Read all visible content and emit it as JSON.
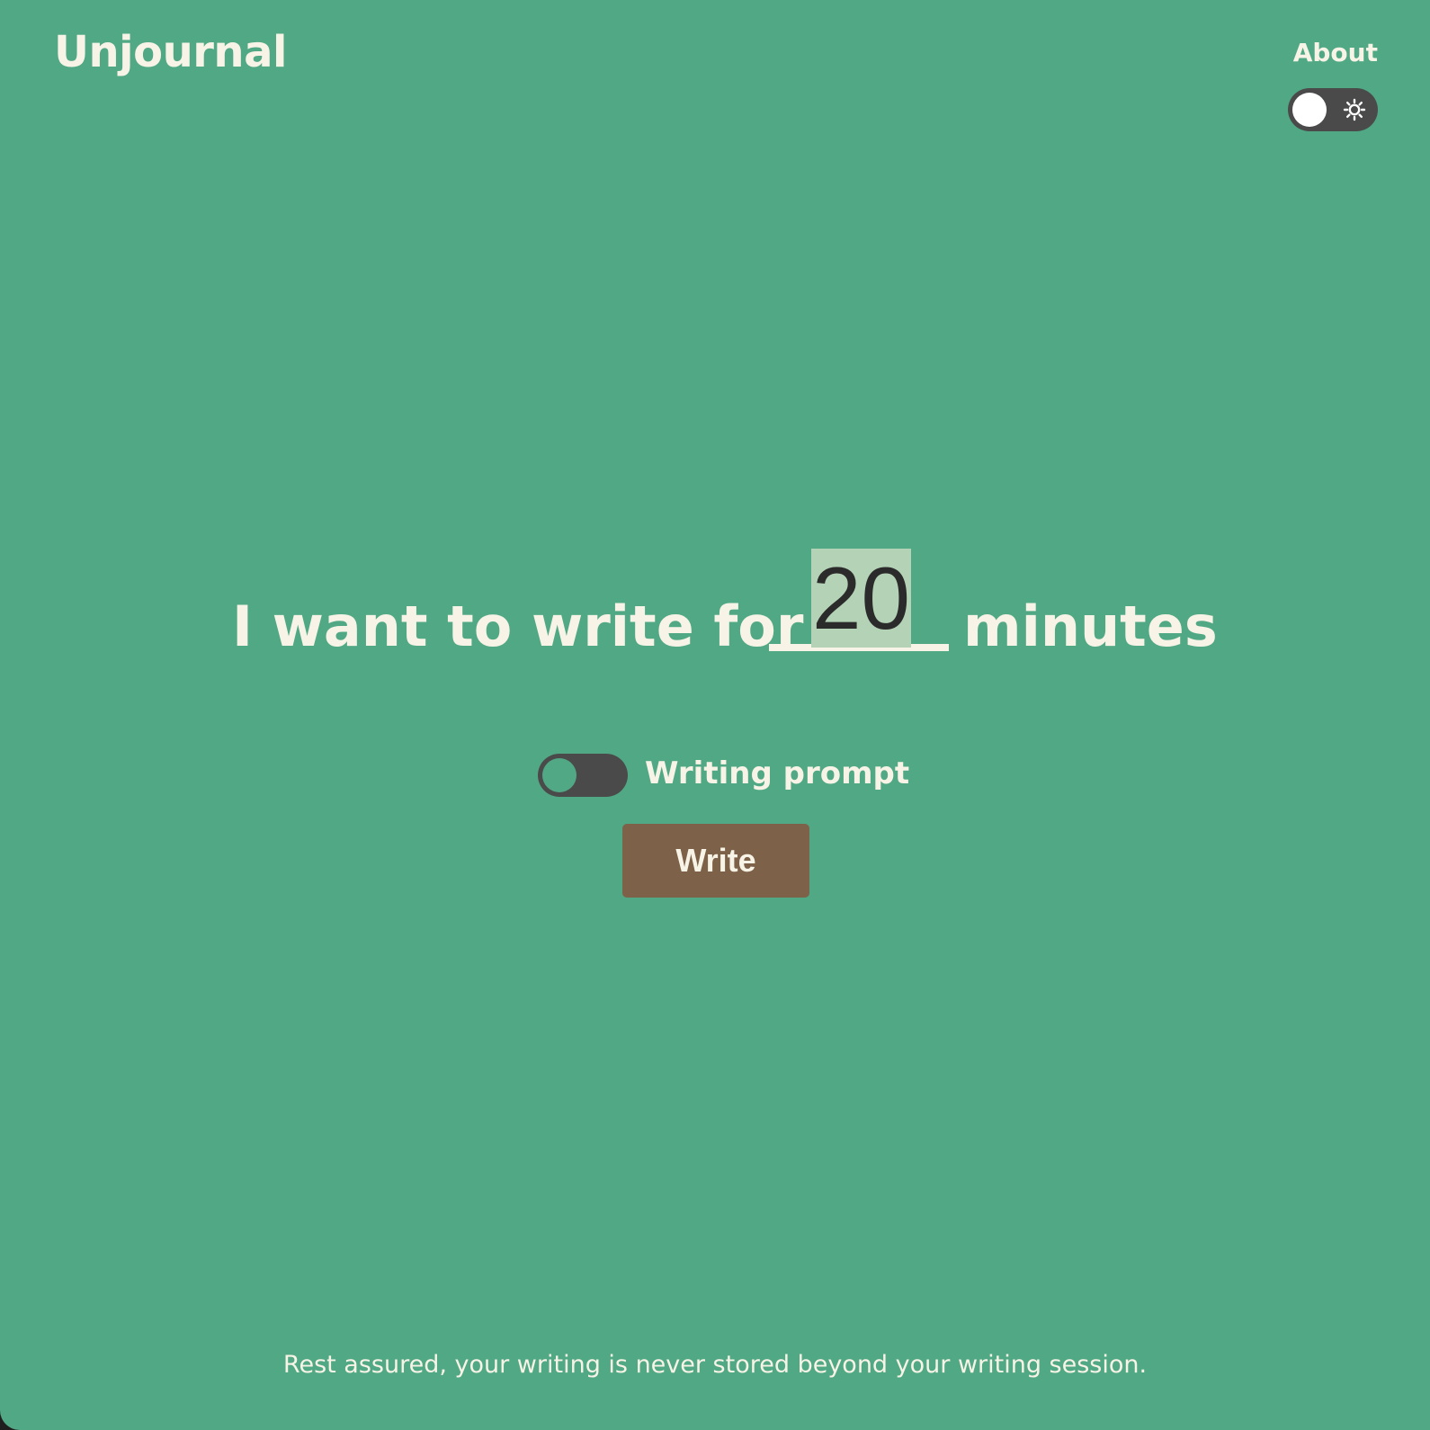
{
  "header": {
    "brand": "Unjournal",
    "about_label": "About",
    "theme_toggle": {
      "state": "off",
      "icon": "sun-icon"
    }
  },
  "main": {
    "lead_text": "I want to write for",
    "minutes_value": "20",
    "tail_text": "minutes",
    "prompt_toggle": {
      "label": "Writing prompt",
      "state": "off"
    },
    "write_label": "Write"
  },
  "footer": {
    "note": "Rest assured, your writing is never stored beyond your writing session."
  },
  "colors": {
    "background": "#51a885",
    "text": "#f7f3e6",
    "toggle_track": "#4a4a4a",
    "input_highlight": "#b4d3b6",
    "button": "#7e6149"
  }
}
